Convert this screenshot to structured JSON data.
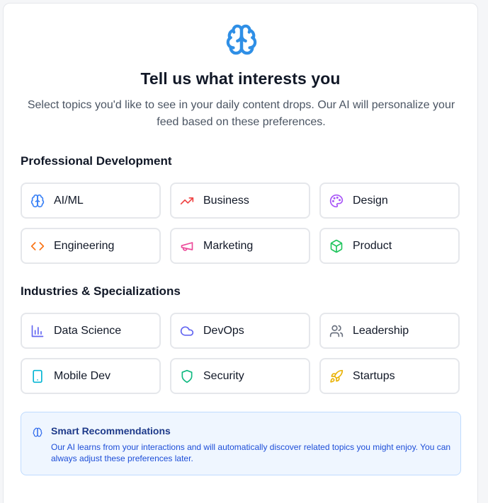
{
  "header": {
    "title": "Tell us what interests you",
    "subtitle": "Select topics you'd like to see in your daily content drops. Our AI will personalize your feed based on these preferences."
  },
  "sections": [
    {
      "title": "Professional Development",
      "topics": [
        {
          "label": "AI/ML",
          "icon": "brain-icon",
          "color": "#3b82f6"
        },
        {
          "label": "Business",
          "icon": "trending-up-icon",
          "color": "#ef4444"
        },
        {
          "label": "Design",
          "icon": "palette-icon",
          "color": "#a855f7"
        },
        {
          "label": "Engineering",
          "icon": "code-icon",
          "color": "#f97316"
        },
        {
          "label": "Marketing",
          "icon": "megaphone-icon",
          "color": "#ec4899"
        },
        {
          "label": "Product",
          "icon": "package-icon",
          "color": "#22c55e"
        }
      ]
    },
    {
      "title": "Industries & Specializations",
      "topics": [
        {
          "label": "Data Science",
          "icon": "bar-chart-icon",
          "color": "#6366f1"
        },
        {
          "label": "DevOps",
          "icon": "cloud-icon",
          "color": "#6366f1"
        },
        {
          "label": "Leadership",
          "icon": "users-icon",
          "color": "#6b7280"
        },
        {
          "label": "Mobile Dev",
          "icon": "smartphone-icon",
          "color": "#06b6d4"
        },
        {
          "label": "Security",
          "icon": "shield-icon",
          "color": "#10b981"
        },
        {
          "label": "Startups",
          "icon": "rocket-icon",
          "color": "#eab308"
        }
      ]
    }
  ],
  "info": {
    "title": "Smart Recommendations",
    "text": "Our AI learns from your interactions and will automatically discover related topics you might enjoy. You can always adjust these preferences later."
  },
  "colors": {
    "accent": "#3b82f6",
    "info_bg": "#eff6ff",
    "info_border": "#bfdbfe"
  }
}
